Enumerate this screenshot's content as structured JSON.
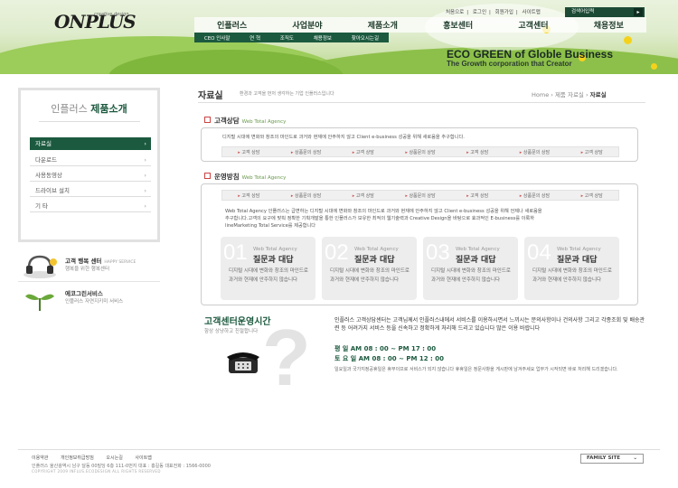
{
  "header": {
    "logo": "ONPLUS",
    "logo_sub": "creative design",
    "top_links": [
      "처음으로",
      "로그인",
      "회원가입",
      "사이트맵"
    ],
    "search_label": "검색어입력",
    "gnb": [
      "인플러스",
      "사업분야",
      "제품소개",
      "홍보센터",
      "고객센터",
      "채용정보"
    ],
    "lnb": [
      "CEO 인사말",
      "연 혁",
      "조직도",
      "채용정보",
      "찾아오시는길"
    ],
    "slogan": "ECO GREEN of Globle Business",
    "slogan2": "The Growth corporation that Creator"
  },
  "sidebar": {
    "title_a": "인플러스",
    "title_b": "제품소개",
    "items": [
      {
        "label": "자료실"
      },
      {
        "label": "다운로드"
      },
      {
        "label": "사용동영상"
      },
      {
        "label": "드라이브 설치"
      },
      {
        "label": "기  타"
      }
    ],
    "promos": [
      {
        "title": "고객 행복 센터",
        "tag": "HAPPY SERVICE",
        "desc": "행복을 위한 행복센터"
      },
      {
        "title": "에코그린서비스",
        "tag": "",
        "desc": "인플러스 자연지키미 서비스"
      }
    ]
  },
  "page": {
    "title": "자료실",
    "desc": "환경과 고객을 먼저 생각하는 기업 인플러스입니다",
    "crumb_home": "Home",
    "crumb_mid": "제품 자료실",
    "crumb_current": "자료실"
  },
  "section1": {
    "title": "고객상담",
    "sub": "Web Total Agency",
    "text": "디지털 시대에 변화와 창조의 마인드로 과거와 현재에 안주하지 않고 Client e-business 성공을 위해 새로움을 추구합니다.",
    "tabs": [
      "고객 상담",
      "상품문의 상담",
      "고객 상담",
      "상품문의 상담",
      "고객 상담",
      "상품문의 상담",
      "고객 상담"
    ]
  },
  "section2": {
    "title": "운영방침",
    "sub": "Web Total Agency",
    "tabs": [
      "고객 상담",
      "상품문의 상담",
      "고객 상담",
      "상품문의 상담",
      "고객 상담",
      "상품문의 상담",
      "고객 상담"
    ],
    "text_1": "Web Total Agency 인플러스는 급변하는 디지털 시대에 변화와 창조의 마인드로 과거와 현재에 안주하지 않고 Client e-business 성공을 위해 언제나 새로움을",
    "text_2": "추구합니다.고객의 요구에 맞춰 정확한 기획개발을 통한 인플러스가 보유한 최적의 웹기술력과 Creative Design을 바탕으로 효과적인 E-business를 이룩하",
    "text_3": "lineMarketing Total Service를 제공합니다",
    "cards": [
      {
        "num": "01",
        "en": "Web Total Agency",
        "title": "질문과 대답",
        "text": "디지털 시대에 변화와 창조의 마인드로 과거와 현재에 안주하지 않습니다"
      },
      {
        "num": "02",
        "en": "Web Total Agency",
        "title": "질문과 대답",
        "text": "디지털 시대에 변화와 창조의 마인드로 과거와 현재에 안주하지 않습니다"
      },
      {
        "num": "03",
        "en": "Web Total Agency",
        "title": "질문과 대답",
        "text": "디지털 시대에 변화와 창조의 마인드로 과거와 현재에 안주하지 않습니다"
      },
      {
        "num": "04",
        "en": "Web Total Agency",
        "title": "질문과 대답",
        "text": "디지털 시대에 변화와 창조의 마인드로 과거와 현재에 안주하지 않습니다"
      }
    ]
  },
  "cs": {
    "title": "고객센터운영시간",
    "sub": "항상 상냥하고 친절합니다",
    "text": "인플러스 고객상담센터는 고객님께서 인플러스내에서 서비스를 이용하시면서 느끼시는 문의사항이나 건의사항 그리고 각종조회 및 배송관련 등 어려가지 서비스 등을 신속하고 정확하게 처리해 드리고 있습니다 많은 이용 바랍니다",
    "weekday": "평    일   AM 08 : 00 ~ PM 17 : 00",
    "saturday": "토 요 일   AM 08 : 00 ~ PM 12 : 00",
    "note": "일요일과 국가지정공휴일은 휴무이므로 서비스가 되지 않습니다 휴휴일은 정문사항을 게시판에 남겨주세요 업무가 시작되면 바로 처리해 드리겠습니다."
  },
  "footer": {
    "links": [
      "이용약관",
      "개인정보취급방침",
      "오시는길",
      "사이트맵"
    ],
    "address": "인플러스 울산광역시 남구 달동 00빌딩 6층 111-0번지    대표 : 홍길동  대표전화 : 1566-0000",
    "copyright": "COPYRIGHT 2009 INFLUS.ECODESIGN ALL RIGHTS RESERVED",
    "family_site": "FAMILY SITE"
  }
}
